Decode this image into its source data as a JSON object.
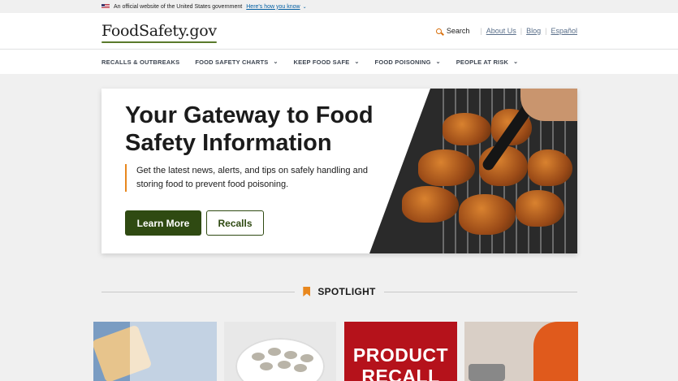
{
  "banner": {
    "text": "An official website of the United States government",
    "link": "Here's how you know"
  },
  "header": {
    "logo": "FoodSafety",
    "logo_tld": ".gov",
    "search_label": "Search",
    "links": [
      "About Us",
      "Blog",
      "Español"
    ]
  },
  "nav": {
    "items": [
      {
        "label": "RECALLS & OUTBREAKS",
        "has_menu": false
      },
      {
        "label": "FOOD SAFETY CHARTS",
        "has_menu": true
      },
      {
        "label": "KEEP FOOD SAFE",
        "has_menu": true
      },
      {
        "label": "FOOD POISONING",
        "has_menu": true
      },
      {
        "label": "PEOPLE AT RISK",
        "has_menu": true
      }
    ]
  },
  "hero": {
    "title": "Your Gateway to Food Safety Information",
    "lede": "Get the latest news, alerts, and tips on safely handling and storing food to prevent food poisoning.",
    "primary_button": "Learn More",
    "secondary_button": "Recalls",
    "image_alt": "chicken on grill"
  },
  "spotlight": {
    "title": "SPOTLIGHT",
    "cards": [
      {
        "image": "sandwich in bag"
      },
      {
        "image": "bowl of raw shrimp"
      },
      {
        "image": "product recall",
        "label": "PRODUCT RECALL"
      },
      {
        "image": "pregnant woman cooking"
      }
    ]
  },
  "colors": {
    "accent": "#e8871e",
    "primary": "#2f4a12",
    "link": "#005ea2"
  }
}
